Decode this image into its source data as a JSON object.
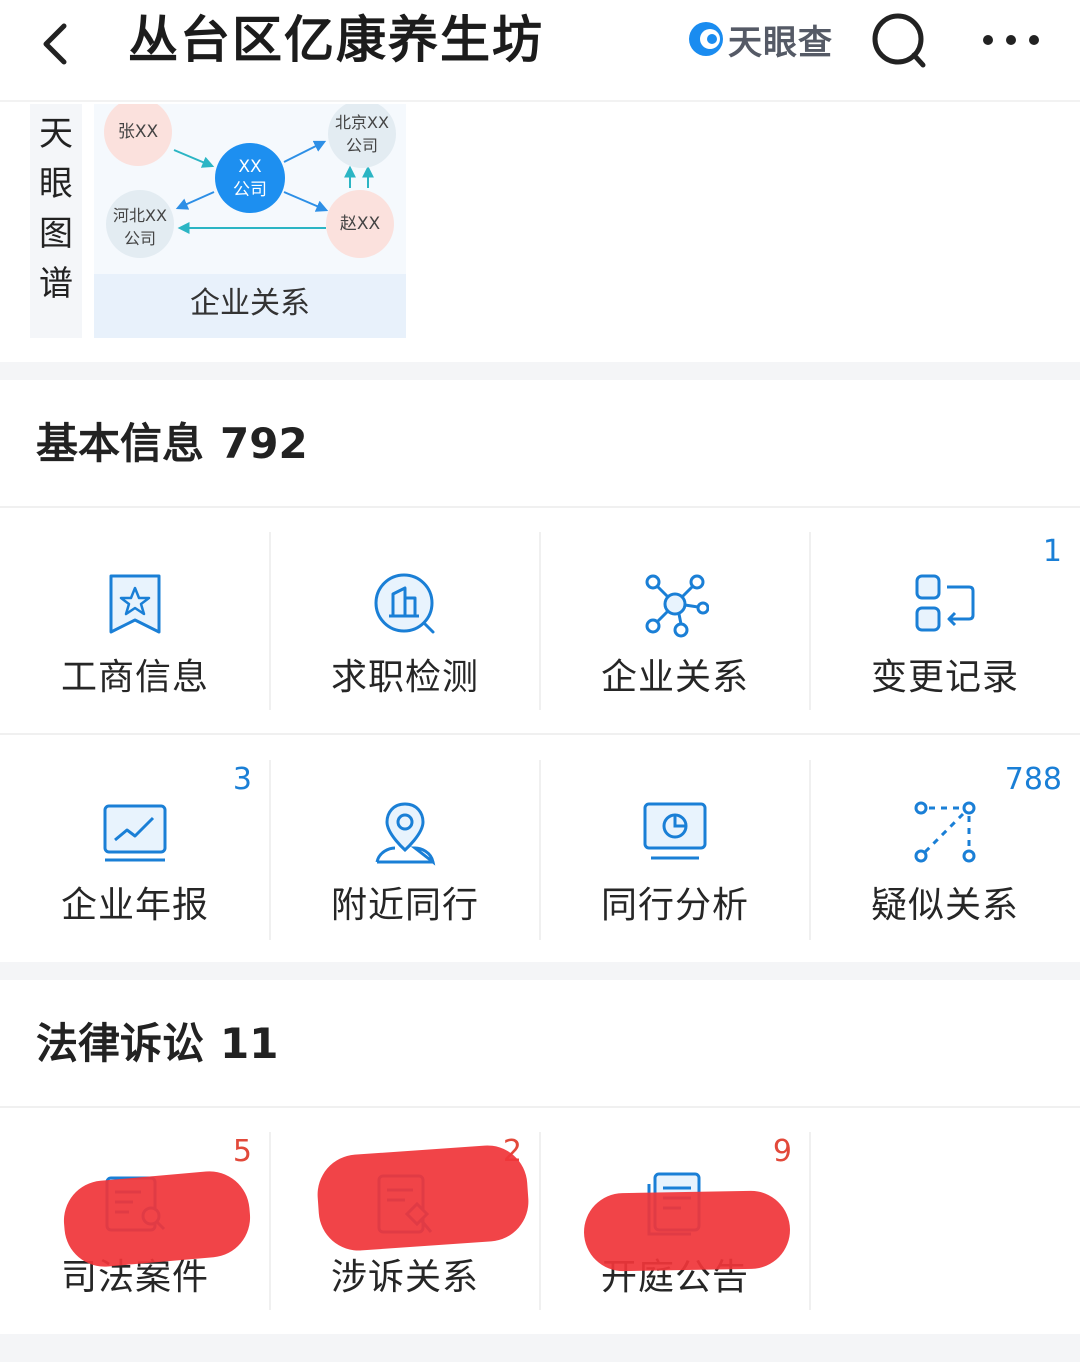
{
  "header": {
    "title": "丛台区亿康养生坊",
    "brand_name": "天眼查",
    "back_icon": "chevron-left-icon",
    "search_icon": "search-icon",
    "more_icon": "more-dots-icon"
  },
  "graph": {
    "tab_chars": [
      "天",
      "眼",
      "图",
      "谱"
    ],
    "nodes": {
      "center_line1": "XX",
      "center_line2": "公司",
      "top_left": "张XX",
      "top_right_line1": "北京XX",
      "top_right_line2": "公司",
      "bottom_left_line1": "河北XX",
      "bottom_left_line2": "公司",
      "bottom_right": "赵XX"
    },
    "caption": "企业关系"
  },
  "basic_info": {
    "title": "基本信息",
    "count": "792",
    "items": [
      {
        "label": "工商信息",
        "icon": "bookmark-star-icon",
        "badge": ""
      },
      {
        "label": "求职检测",
        "icon": "building-search-icon",
        "badge": ""
      },
      {
        "label": "企业关系",
        "icon": "network-nodes-icon",
        "badge": ""
      },
      {
        "label": "变更记录",
        "icon": "change-record-icon",
        "badge": "1"
      },
      {
        "label": "企业年报",
        "icon": "line-chart-icon",
        "badge": "3"
      },
      {
        "label": "附近同行",
        "icon": "location-person-icon",
        "badge": ""
      },
      {
        "label": "同行分析",
        "icon": "monitor-pie-icon",
        "badge": ""
      },
      {
        "label": "疑似关系",
        "icon": "dotted-link-icon",
        "badge": "788"
      }
    ]
  },
  "legal": {
    "title": "法律诉讼",
    "count": "11",
    "items": [
      {
        "label": "司法案件",
        "icon": "case-search-icon",
        "badge": "5"
      },
      {
        "label": "涉诉关系",
        "icon": "document-gavel-icon",
        "badge": "2"
      },
      {
        "label": "开庭公告",
        "icon": "notice-document-icon",
        "badge": "9"
      }
    ]
  },
  "colors": {
    "icon_blue": "#1a7fd6",
    "badge_red": "#e2493a",
    "redaction": "#f0363a"
  }
}
